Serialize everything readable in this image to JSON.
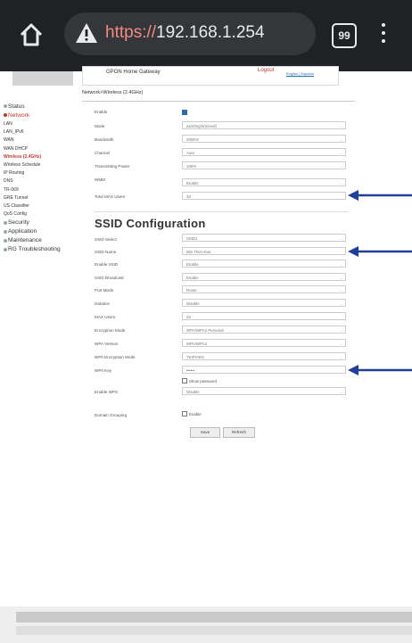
{
  "browser": {
    "url_scheme": "https://",
    "url_host": "192.168.1.254",
    "tab_count": "99"
  },
  "header": {
    "title": "GPON Home Gateway",
    "logout": "Logout",
    "language": "English | Español"
  },
  "breadcrumb": "Network>Wireless (2.4GHz)",
  "sidebar": {
    "status": "Status",
    "network": "Network",
    "network_items": [
      "LAN",
      "LAN_IPv6",
      "WAN",
      "WAN DHCP",
      "Wireless (2.4GHz)",
      "Wireless Schedule",
      "IP Routing",
      "DNS",
      "TR-069",
      "GRE Tunnel",
      "US Classifier",
      "QoS Config"
    ],
    "security": "Security",
    "application": "Application",
    "maintenance": "Maintenance",
    "troubleshooting": "RG Troubleshooting"
  },
  "wireless": {
    "enable_label": "Enable",
    "mode_label": "Mode",
    "mode_value": "ax/n/b/g/n(mixed)",
    "bandwidth_label": "Bandwidth",
    "bandwidth_value": "20MHz",
    "channel_label": "Channel",
    "channel_value": "Auto",
    "tx_power_label": "Transmitting Power",
    "tx_power_value": "100%",
    "wmm_label": "WMM",
    "wmm_value": "Enable",
    "total_max_users_label": "Total MAX Users",
    "total_max_users_value": "32"
  },
  "ssid": {
    "section_title": "SSID Configuration",
    "ssid_select_label": "SSID Select",
    "ssid_select_value": "SSID1",
    "ssid_name_label": "SSID Name",
    "ssid_name_value": "Min Thet Htun",
    "enable_ssid_label": "Enable SSID",
    "enable_ssid_value": "Enable",
    "ssid_broadcast_label": "SSID Broadcast",
    "ssid_broadcast_value": "Enable",
    "port_mode_label": "Port Mode",
    "port_mode_value": "Route",
    "isolation_label": "Isolation",
    "isolation_value": "Disable",
    "max_users_label": "MAX Users",
    "max_users_value": "32",
    "enc_mode_label": "Encryption Mode",
    "enc_mode_value": "WPA/WPA2 Personal",
    "wpa_version_label": "WPA Version",
    "wpa_version_value": "WPA/WPA2",
    "wpa_enc_mode_label": "WPA Encryption Mode",
    "wpa_enc_mode_value": "TKIP/AES",
    "wpa_key_label": "WPA Key",
    "wpa_key_value": "••••••",
    "show_password": "Show password",
    "enable_wps_label": "Enable WPS",
    "enable_wps_value": "Disable",
    "domain_grouping_label": "Domain Grouping",
    "domain_grouping_value": "Enable"
  },
  "buttons": {
    "save": "Save",
    "refresh": "Refresh"
  },
  "colors": {
    "arrow": "#1f3f9a",
    "accent_red": "#c0392b",
    "chrome_bg": "#202124"
  }
}
